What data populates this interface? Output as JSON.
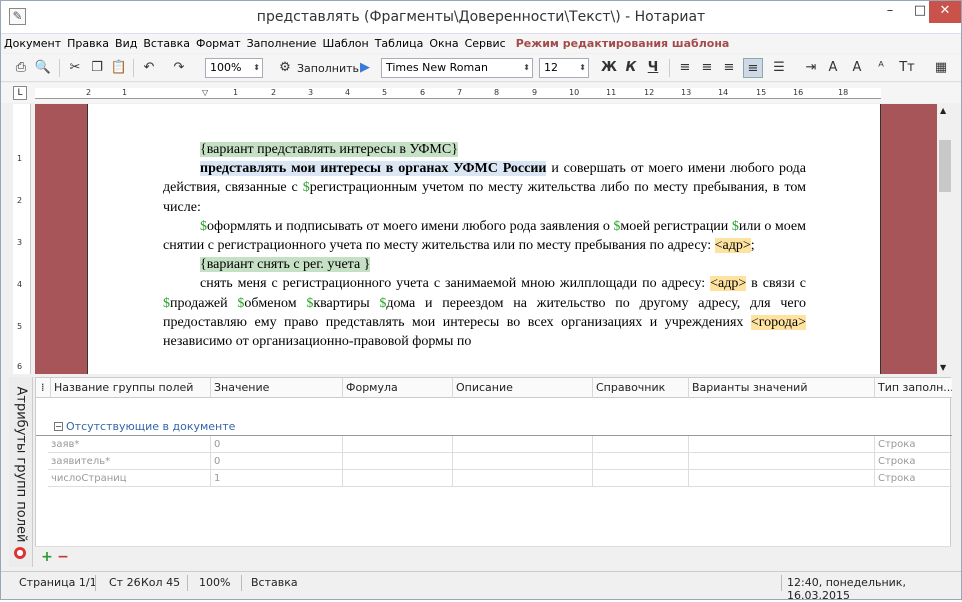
{
  "window": {
    "title": "представлять (Фрагменты\\Доверенности\\Текст\\) - Нотариат",
    "min_icon": "minimize-icon",
    "max_icon": "maximize-icon",
    "close_icon": "close-icon"
  },
  "menu": {
    "items": [
      "Документ",
      "Правка",
      "Вид",
      "Вставка",
      "Формат",
      "Заполнение",
      "Шаблон",
      "Таблица",
      "Окна",
      "Сервис"
    ],
    "mode_label": "Режим редактирования шаблона",
    "mode_color": "#a34b4b"
  },
  "toolbar": {
    "zoom": "100%",
    "fill_label": "Заполнить",
    "font": "Times New Roman",
    "font_size": "12",
    "bold": "Ж",
    "italic": "К",
    "underline": "Ч"
  },
  "ruler": {
    "marks": [
      "2",
      "1",
      "1",
      "2",
      "3",
      "4",
      "5",
      "6",
      "7",
      "8",
      "9",
      "10",
      "11",
      "12",
      "13",
      "14",
      "15",
      "16",
      "18"
    ],
    "vmarks": [
      "1",
      "2",
      "3",
      "4",
      "5",
      "6"
    ]
  },
  "document": {
    "p1": "{вариант представлять интересы в УФМС}",
    "p2_bold": "представлять мои интересы в органах УФМС России",
    "p2_rest": " и совершать от моего имени любого рода действия, связанные с ",
    "p2_dollar": "$",
    "p2_tail": "регистрационным учетом по месту жительства либо по месту пребывания, в том числе:",
    "p3_d1": "$",
    "p3_a": "оформлять и подписывать от моего имени любого рода заявления о ",
    "p3_d2": "$",
    "p3_b": "моей регистрации ",
    "p3_d3": "$",
    "p3_c": "или о моем снятии с регистрационного учета по месту жительства или по месту пребывания по адресу: ",
    "p3_addr": "<адр>",
    "p3_end": ";",
    "p4": "{вариант снять с рег. учета }",
    "p5_a": "снять меня с регистрационного учета с занимаемой мною жилплощади по адресу: ",
    "p5_addr": "<адр>",
    "p5_b": " в связи с ",
    "p5_d1": "$",
    "p5_c": "продажей ",
    "p5_d2": "$",
    "p5_d": "обменом ",
    "p5_d3": "$",
    "p5_e": "квартиры ",
    "p5_d4": "$",
    "p5_f": "дома и переездом на жительство по другому адресу, для чего предоставляю ему право представлять мои интересы во всех организациях и учреждениях ",
    "p5_city": "<города>",
    "p5_g": " независимо от организационно-правовой формы по"
  },
  "side_tab": {
    "label": "Атрибуты групп полей"
  },
  "grid": {
    "columns": [
      "Название группы полей",
      "Значение",
      "Формула",
      "Описание",
      "Справочник",
      "Варианты значений",
      "Тип заполн..."
    ],
    "group_label": "Отсутствующие в документе",
    "rows": [
      {
        "name": "заяв*",
        "value": "0",
        "type": "Строка"
      },
      {
        "name": "заявитель*",
        "value": "0",
        "type": "Строка"
      },
      {
        "name": "числоСтраниц",
        "value": "1",
        "type": "Строка"
      }
    ]
  },
  "status": {
    "page": "Страница 1/1",
    "line": "Ст 26",
    "col": "Кол 45",
    "zoom": "100%",
    "mode": "Вставка",
    "datetime": "12:40, понедельник, 16.03.2015"
  }
}
